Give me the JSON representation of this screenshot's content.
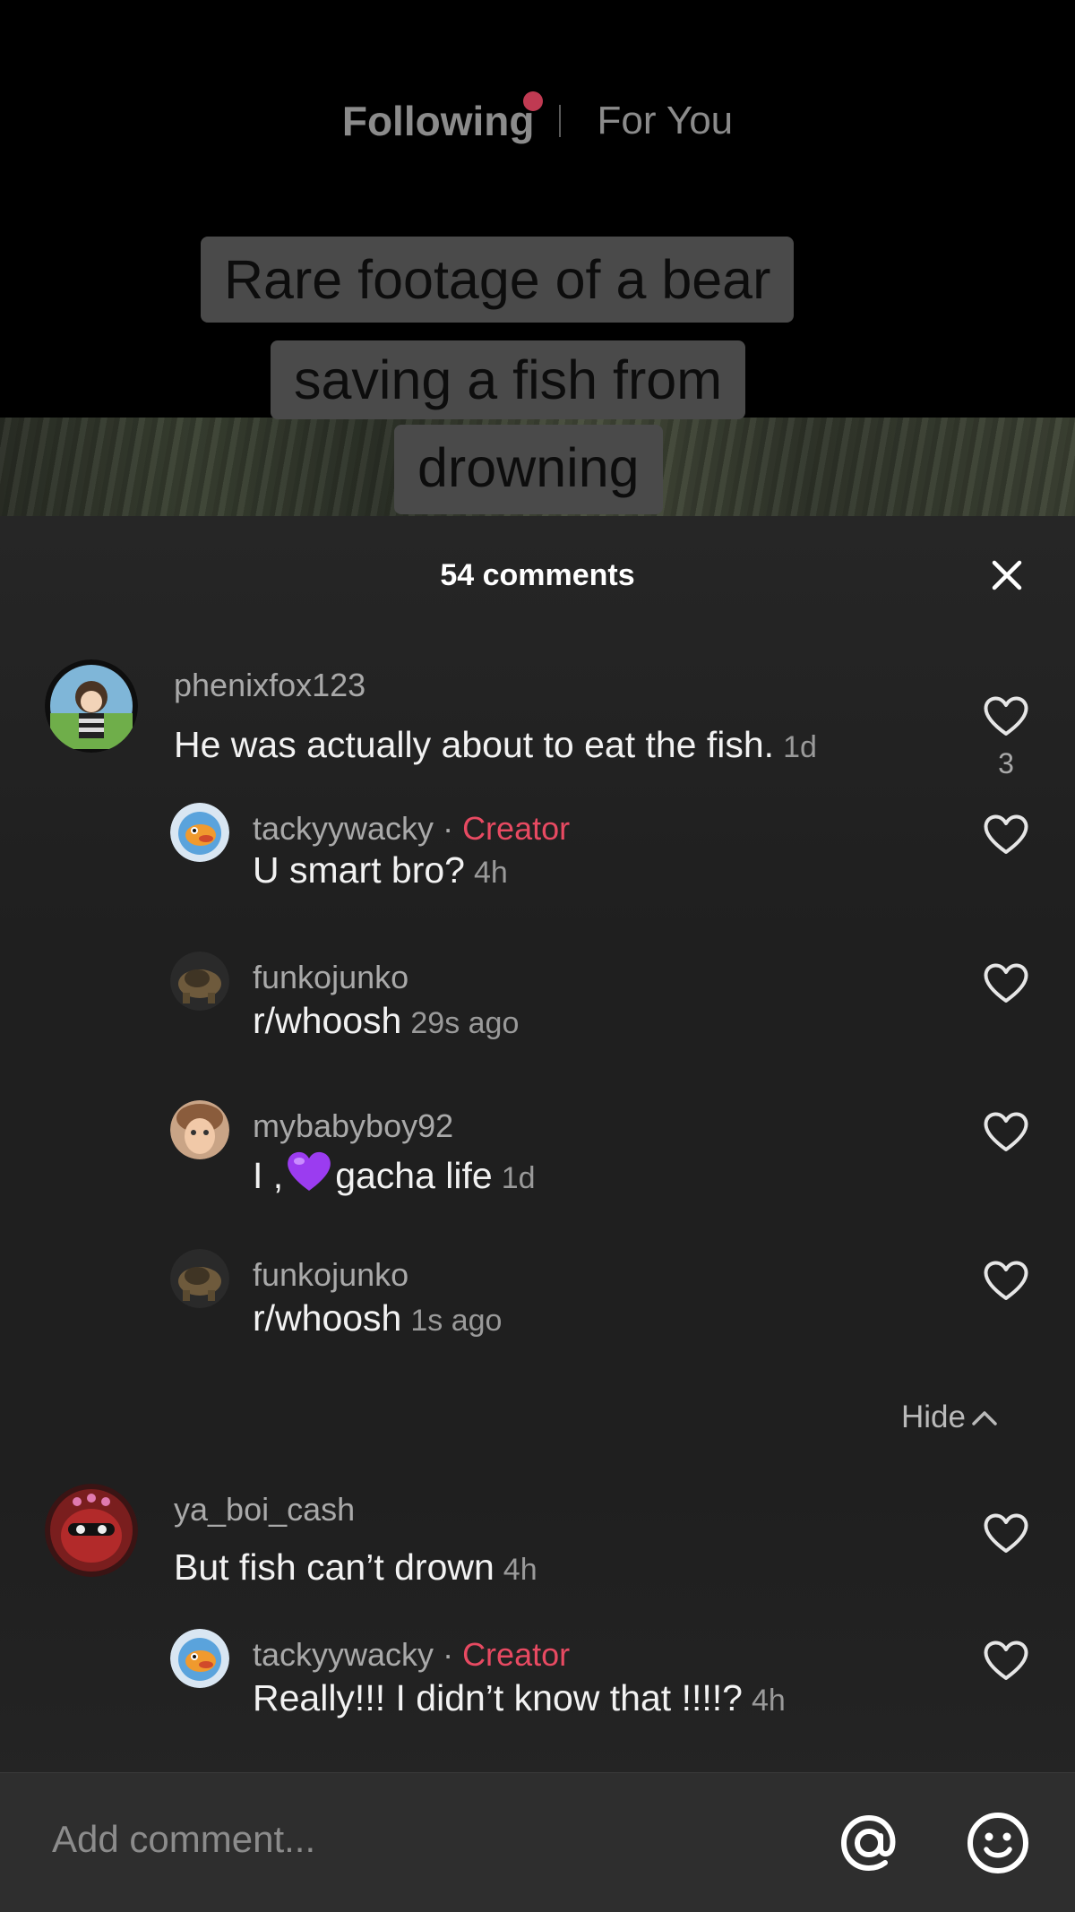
{
  "top_tabs": {
    "following": "Following",
    "for_you": "For You"
  },
  "video": {
    "caption_lines": [
      "Rare footage of a bear",
      "saving a fish from",
      "drowning"
    ]
  },
  "comments_panel": {
    "count_label": "54 comments",
    "close_icon": "close-icon",
    "hide_label": "Hide"
  },
  "comments": [
    {
      "username": "phenixfox123",
      "text": "He was actually about to eat the fish.",
      "time": "1d",
      "likes": "3"
    },
    {
      "username": "tackyywacky",
      "badge": "Creator",
      "text": "U smart bro?",
      "time": "4h"
    },
    {
      "username": "funkojunko",
      "text": "r/whoosh",
      "time": "29s ago"
    },
    {
      "username": "mybabyboy92",
      "text_before": "I ,",
      "text_after": "gacha life",
      "time": "1d"
    },
    {
      "username": "funkojunko",
      "text": "r/whoosh",
      "time": "1s ago"
    },
    {
      "username": "ya_boi_cash",
      "text": "But fish can’t drown",
      "time": "4h"
    },
    {
      "username": "tackyywacky",
      "badge": "Creator",
      "text": "Really!!! I didn’t know that !!!!?",
      "time": "4h"
    }
  ],
  "composer": {
    "placeholder": "Add comment...",
    "mention_icon": "at-icon",
    "emoji_icon": "emoji-icon"
  },
  "colors": {
    "creator_badge": "#e84a62",
    "sheet_background": "#1f1f1f",
    "tab_dot": "#c03a52"
  }
}
